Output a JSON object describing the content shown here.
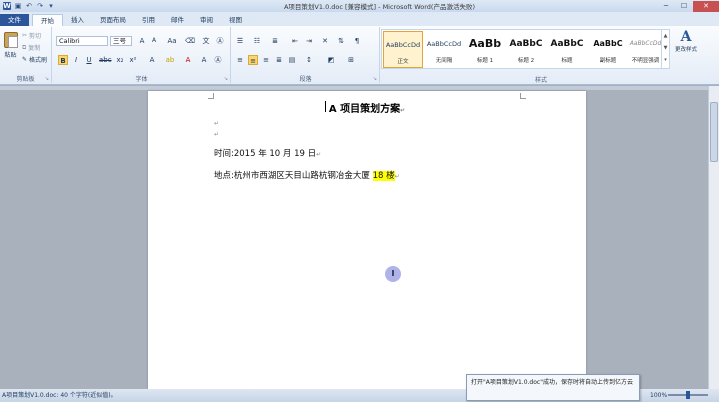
{
  "window": {
    "title": "A项目策划V1.0.doc [兼容模式] - Microsoft Word(产品激活失败)",
    "minimize": "─",
    "maximize": "☐",
    "close": "✕"
  },
  "tabs": [
    "文件",
    "开始",
    "插入",
    "页面布局",
    "引用",
    "邮件",
    "审阅",
    "视图"
  ],
  "ribbon": {
    "clipboard": {
      "paste": "粘贴",
      "cut": "剪切",
      "copy": "复制",
      "format_painter": "格式刷",
      "label": "剪贴板"
    },
    "font": {
      "name": "Calibri",
      "size": "三号",
      "label": "字体"
    },
    "paragraph": {
      "label": "段落"
    },
    "styles": {
      "label": "样式",
      "items": [
        {
          "sample": "AaBbCcDd",
          "name": "正文"
        },
        {
          "sample": "AaBbCcDd",
          "name": "无间隔"
        },
        {
          "sample": "AaBb",
          "name": "标题 1"
        },
        {
          "sample": "AaBbC",
          "name": "标题 2"
        },
        {
          "sample": "AaBbC",
          "name": "标题"
        },
        {
          "sample": "AaBbC",
          "name": "副标题"
        },
        {
          "sample": "AaBbCcDd",
          "name": "不明显强调"
        }
      ],
      "change_styles": "更改样式"
    }
  },
  "document": {
    "title": "A 项目策划方案",
    "date_line": "时间:2015 年 10 月 19 日",
    "location_prefix": "地点:杭州市西湖区天目山路杭钢冶金大厦",
    "location_highlight": "18 楼",
    "para_mark": "↵"
  },
  "status": {
    "left": "A项目策划V1.0.doc: 40 个字符(近似值)。",
    "zoom": "100%",
    "toast": "打开\"A项目策划V1.0.doc\"成功，保存时将自动上传到亿方云"
  }
}
